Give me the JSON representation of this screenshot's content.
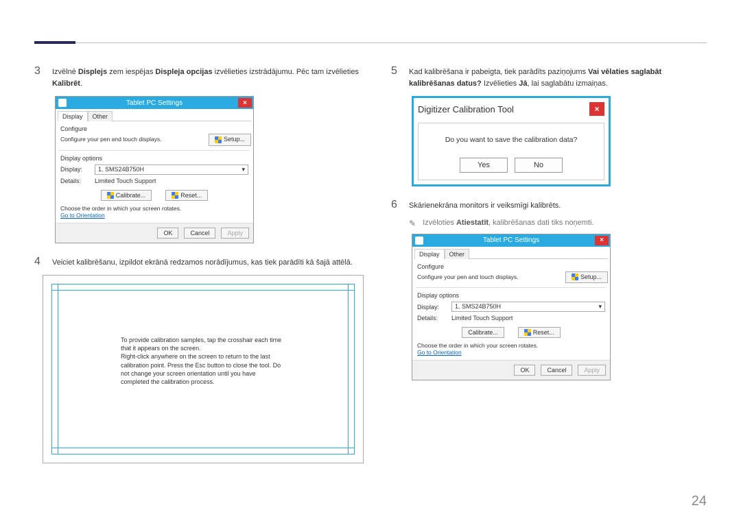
{
  "page_number": "24",
  "left": {
    "step3": {
      "num": "3",
      "pre": "Izvēlnē ",
      "bold1": "Displejs",
      "mid1": " zem iespējas ",
      "bold2": "Displeja opcijas",
      "mid2": " izvēlieties izstrādājumu. Pēc tam izvēlieties ",
      "bold3": "Kalibrēt",
      "end": "."
    },
    "step4": {
      "num": "4",
      "text": "Veiciet kalibrēšanu, izpildot ekrānā redzamos norādījumus, kas tiek parādīti kā šajā attēlā."
    },
    "calib_text": "To provide calibration samples, tap the crosshair each time that it appears on the screen.\nRight-click anywhere on the screen to return to the last calibration point. Press the Esc button to close the tool. Do not change your screen orientation until you have completed the calibration process."
  },
  "right": {
    "step5": {
      "num": "5",
      "pre": "Kad kalibrēšana ir pabeigta, tiek parādīts paziņojums ",
      "bold1": "Vai vēlaties saglabāt kalibrēšanas datus?",
      "mid": " Izvēlieties ",
      "bold2": "Jā",
      "end": ", lai saglabātu izmaiņas."
    },
    "step6": {
      "num": "6",
      "text": "Skārienekrāna monitors ir veiksmīgi kalibrēts."
    },
    "note": {
      "pre": "Izvēloties ",
      "bold": "Atiestatīt",
      "end": ", kalibrēšanas dati tiks noņemti."
    }
  },
  "tablet_dialog": {
    "title": "Tablet PC Settings",
    "tabs": {
      "display": "Display",
      "other": "Other"
    },
    "configure_label": "Configure",
    "configure_text": "Configure your pen and touch displays.",
    "setup_btn": "Setup...",
    "display_options_label": "Display options",
    "display_label": "Display:",
    "display_value": "1. SMS24B750H",
    "details_label": "Details:",
    "details_value": "Limited Touch Support",
    "calibrate_btn": "Calibrate...",
    "reset_btn": "Reset...",
    "order_text": "Choose the order in which your screen rotates.",
    "orientation_link": "Go to Orientation",
    "ok": "OK",
    "cancel": "Cancel",
    "apply": "Apply"
  },
  "digitizer": {
    "title": "Digitizer Calibration Tool",
    "question": "Do you want to save the calibration data?",
    "yes": "Yes",
    "no": "No"
  }
}
